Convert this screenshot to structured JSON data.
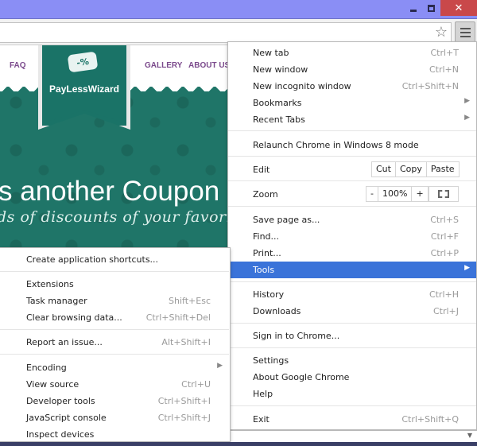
{
  "window": {
    "controls": {
      "minimize": "minimize-icon",
      "maximize": "restore-icon",
      "close": "✕"
    }
  },
  "toolbar": {
    "star_icon": "☆",
    "menu_icon": "hamburger-icon"
  },
  "page": {
    "nav": {
      "faq": "FAQ",
      "gallery": "GALLERY",
      "about": "ABOUT US"
    },
    "brand": "PayLessWizard",
    "coupon_glyph": "-%",
    "headline": "s another Coupon",
    "tagline": "ds of discounts of your favorite"
  },
  "menu": {
    "items": [
      {
        "label": "New tab",
        "shortcut": "Ctrl+T"
      },
      {
        "label": "New window",
        "shortcut": "Ctrl+N"
      },
      {
        "label": "New incognito window",
        "shortcut": "Ctrl+Shift+N"
      },
      {
        "label": "Bookmarks",
        "submenu": true
      },
      {
        "label": "Recent Tabs",
        "submenu": true
      },
      {
        "label": "Relaunch Chrome in Windows 8 mode"
      },
      {
        "label": "Edit"
      },
      {
        "label": "Zoom"
      },
      {
        "label": "Save page as...",
        "shortcut": "Ctrl+S"
      },
      {
        "label": "Find...",
        "shortcut": "Ctrl+F"
      },
      {
        "label": "Print...",
        "shortcut": "Ctrl+P"
      },
      {
        "label": "Tools",
        "submenu": true,
        "highlighted": true
      },
      {
        "label": "History",
        "shortcut": "Ctrl+H"
      },
      {
        "label": "Downloads",
        "shortcut": "Ctrl+J"
      },
      {
        "label": "Sign in to Chrome..."
      },
      {
        "label": "Settings"
      },
      {
        "label": "About Google Chrome"
      },
      {
        "label": "Help"
      },
      {
        "label": "Exit",
        "shortcut": "Ctrl+Shift+Q"
      }
    ],
    "edit_buttons": {
      "cut": "Cut",
      "copy": "Copy",
      "paste": "Paste"
    },
    "zoom_controls": {
      "minus": "-",
      "level": "100%",
      "plus": "+"
    },
    "submenu_arrow": "▶",
    "scroll_arrow": "▼"
  },
  "tools_submenu": {
    "items": [
      {
        "label": "Create application shortcuts..."
      },
      {
        "label": "Extensions"
      },
      {
        "label": "Task manager",
        "shortcut": "Shift+Esc"
      },
      {
        "label": "Clear browsing data...",
        "shortcut": "Ctrl+Shift+Del"
      },
      {
        "label": "Report an issue...",
        "shortcut": "Alt+Shift+I"
      },
      {
        "label": "Encoding",
        "submenu": true
      },
      {
        "label": "View source",
        "shortcut": "Ctrl+U"
      },
      {
        "label": "Developer tools",
        "shortcut": "Ctrl+Shift+I"
      },
      {
        "label": "JavaScript console",
        "shortcut": "Ctrl+Shift+J"
      },
      {
        "label": "Inspect devices"
      }
    ]
  },
  "colors": {
    "titlebar": "#8a8ef5",
    "close_button": "#c9484a",
    "highlight": "#3a73d9",
    "hero_teal": "#1f7568",
    "nav_link": "#7b4a8c"
  }
}
